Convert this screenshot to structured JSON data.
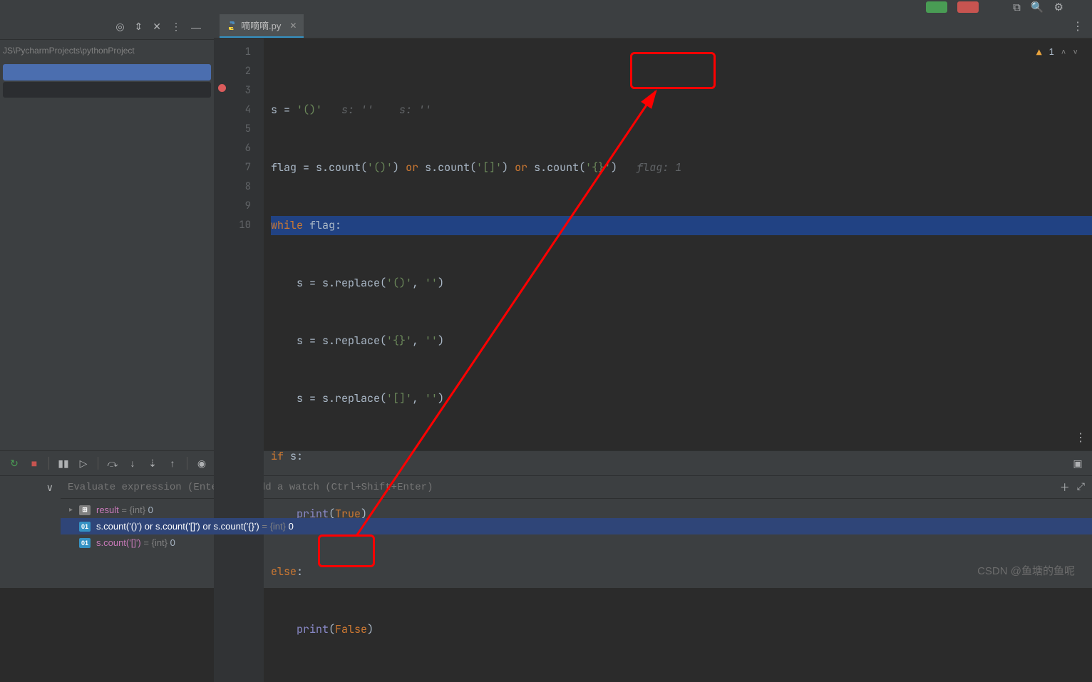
{
  "topbar": {
    "icons": [
      "add",
      "search",
      "bell"
    ]
  },
  "left": {
    "breadcrumb": "JS\\PycharmProjects\\pythonProject"
  },
  "tabs": [
    {
      "label": "嘀嘀嘀.py"
    }
  ],
  "editor": {
    "warning_count": "1",
    "lines": {
      "l1_a": "s = ",
      "l1_b": "'()'",
      "l1_c": "   s: ''    s: ''",
      "l2_a": "flag = ",
      "l2_b": "s.count(",
      "l2_c": "'()'",
      "l2_d": ") ",
      "l2_or": "or",
      "l2_e": " s.count(",
      "l2_f": "'[]'",
      "l2_g": ") ",
      "l2_h": " s.count(",
      "l2_i": "'{}'",
      "l2_j": ")",
      "l2_hint": "   flag: 1",
      "l3_a": "while",
      "l3_b": " flag:",
      "l4_a": "    s = s.replace(",
      "l4_b": "'()'",
      "l4_c": ", ",
      "l4_d": "''",
      "l4_e": ")",
      "l5_a": "    s = s.replace(",
      "l5_b": "'{}'",
      "l5_c": ", ",
      "l5_d": "''",
      "l5_e": ")",
      "l6_a": "    s = s.replace(",
      "l6_b": "'[]'",
      "l6_c": ", ",
      "l6_d": "''",
      "l6_e": ")",
      "l7_a": "if",
      "l7_b": " s:",
      "l8_a": "    ",
      "l8_b": "print",
      "l8_c": "(",
      "l8_d": "True",
      "l8_e": ")",
      "l9_a": "else",
      "l9_b": ":",
      "l10_a": "    ",
      "l10_b": "print",
      "l10_c": "(",
      "l10_d": "False",
      "l10_e": ")"
    }
  },
  "debug": {
    "eval_placeholder": "Evaluate expression (Enter) or add a watch (Ctrl+Shift+Enter)",
    "watches": [
      {
        "icon": "tbl",
        "expr": "result",
        "eq": " = ",
        "type": "{int}",
        "val": " 0"
      },
      {
        "icon": "01",
        "expr": "s.count('()') or s.count('[]') or s.count('{}')",
        "eq": " = ",
        "type": "{int}",
        "val": " 0"
      },
      {
        "icon": "01",
        "expr": "s.count('[]')",
        "eq": " = ",
        "type": "{int}",
        "val": " 0"
      }
    ]
  },
  "watermark": "CSDN @鱼塘的鱼呢"
}
